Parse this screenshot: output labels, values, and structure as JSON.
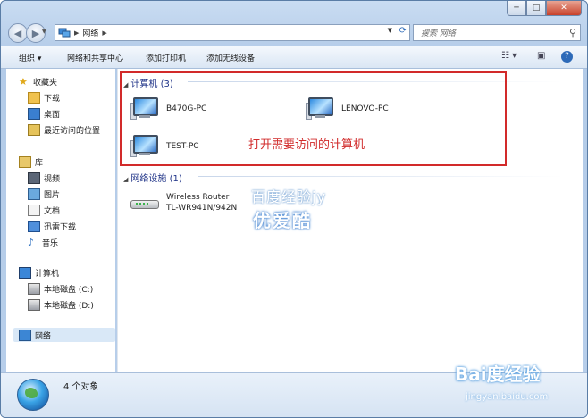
{
  "window": {
    "controls": {
      "minimize": "─",
      "maximize": "□",
      "close": "✕"
    }
  },
  "address_bar": {
    "separator": "▶",
    "path": "网络",
    "trailing_separator": "▶"
  },
  "search": {
    "placeholder": "搜索 网络"
  },
  "toolbar": {
    "organize": "组织 ▾",
    "network_center": "网络和共享中心",
    "add_printer": "添加打印机",
    "add_wireless": "添加无线设备"
  },
  "sidebar": {
    "favorites": "收藏夹",
    "downloads": "下载",
    "desktop": "桌面",
    "recent": "最近访问的位置",
    "libraries": "库",
    "videos": "视频",
    "pictures": "图片",
    "documents": "文档",
    "thunder": "迅雷下载",
    "music": "音乐",
    "computer": "计算机",
    "disk_c": "本地磁盘 (C:)",
    "disk_d": "本地磁盘 (D:)",
    "network": "网络"
  },
  "content": {
    "computers_group": "计算机 (3)",
    "computers": [
      "B470G-PC",
      "LENOVO-PC",
      "TEST-PC"
    ],
    "infra_group": "网络设施 (1)",
    "router_line1": "Wireless Router",
    "router_line2": "TL-WR941N/942N"
  },
  "annotation": "打开需要访问的计算机",
  "watermarks": {
    "line1": "百度经验jy",
    "line2": "优爱酷",
    "baidu": "Bai度经验",
    "baidu_sub": "jingyan.baidu.com"
  },
  "status": {
    "count": "4 个对象"
  }
}
